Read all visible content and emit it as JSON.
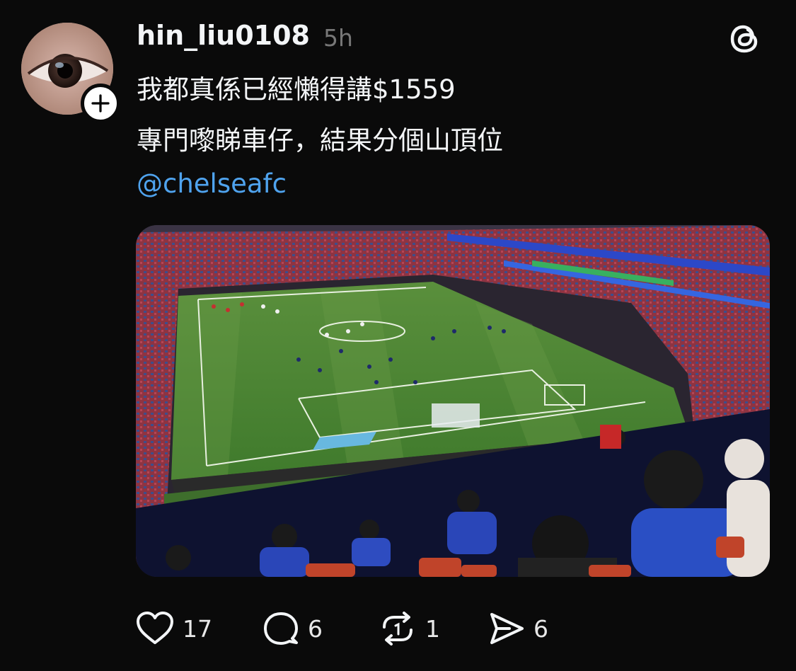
{
  "post": {
    "username": "hin_liu0108",
    "time": "5h",
    "line1": "我都真係已經懶得講$1559",
    "line2": "專門嚟睇車仔，結果分個山頂位",
    "mention": "@chelseafc"
  },
  "actions": {
    "likes": "17",
    "comments": "6",
    "reposts": "1",
    "shares": "6"
  },
  "icons": [
    "heart-icon",
    "comment-icon",
    "repost-icon",
    "share-icon",
    "threads-logo-icon",
    "plus-icon"
  ]
}
